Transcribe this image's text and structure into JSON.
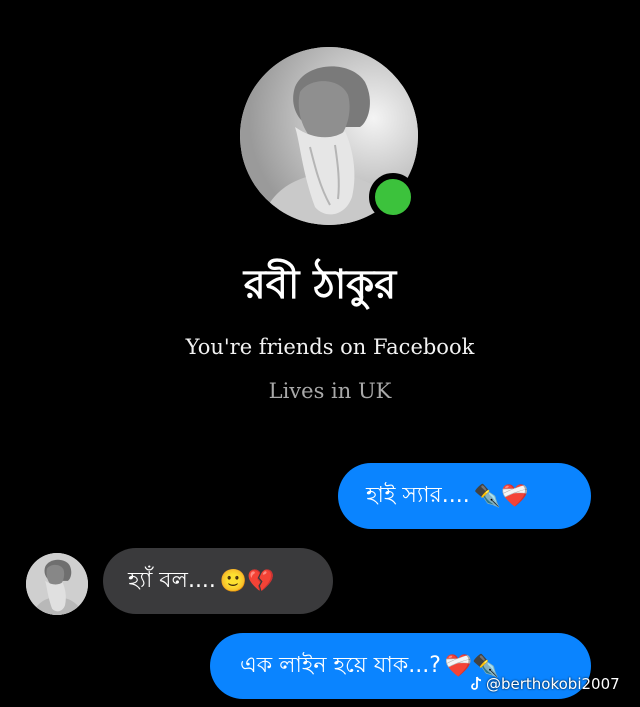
{
  "profile": {
    "name": "রবী ঠাকুর",
    "friends_text": "You're friends on Facebook",
    "lives_text": "Lives in UK",
    "online": true,
    "avatar_icon": "profile-photo-bearded-man"
  },
  "messages": [
    {
      "direction": "outgoing",
      "text": "হাই স্যার....",
      "emoji": "✒️❤️‍🩹"
    },
    {
      "direction": "incoming",
      "text": "হ্যাঁ বল....",
      "emoji": "🙂💔"
    },
    {
      "direction": "outgoing",
      "text": "এক লাইন হয়ে যাক...?",
      "emoji": "❤️‍🩹✒️"
    }
  ],
  "watermark": {
    "text": "@berthokobi2007",
    "icon": "tiktok-icon"
  },
  "colors": {
    "background": "#000000",
    "outgoing_bubble": "#0a84ff",
    "incoming_bubble": "#3a3a3c",
    "online_dot": "#3cc23c",
    "secondary_text": "#a9a9a9"
  }
}
